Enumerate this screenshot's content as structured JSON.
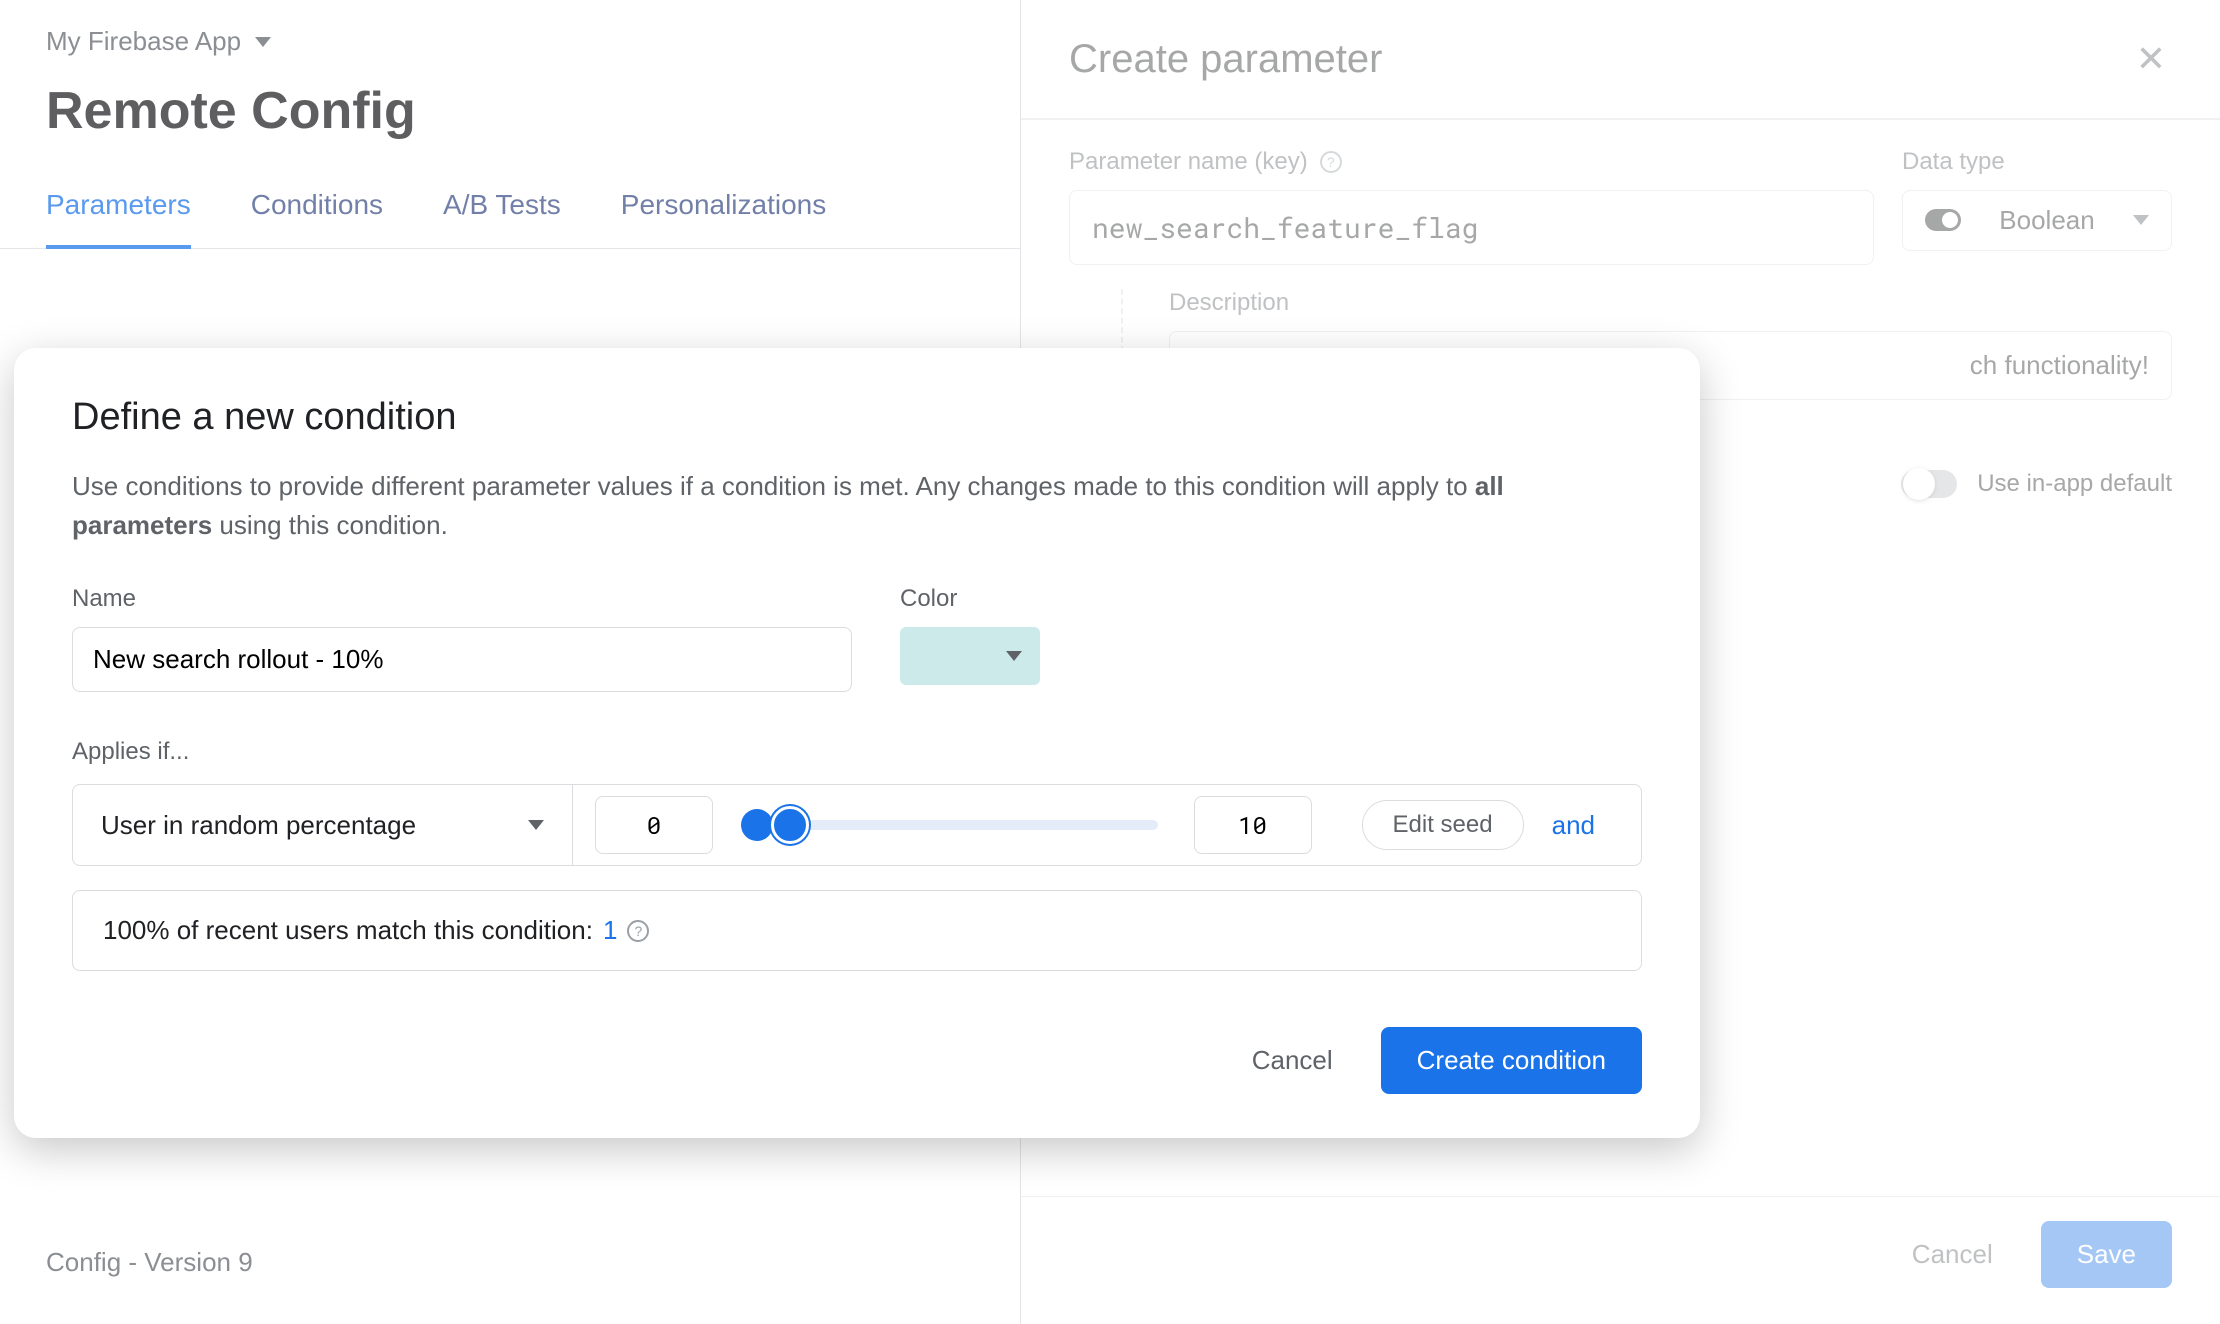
{
  "project": {
    "name": "My Firebase App"
  },
  "page": {
    "title": "Remote Config",
    "version": "Config - Version 9"
  },
  "tabs": [
    "Parameters",
    "Conditions",
    "A/B Tests",
    "Personalizations"
  ],
  "active_tab": 0,
  "drawer": {
    "title": "Create parameter",
    "param_label": "Parameter name (key)",
    "param_value": "new_search_feature_flag",
    "type_label": "Data type",
    "type_value": "Boolean",
    "desc_label": "Description",
    "desc_value_suffix": "ch functionality!",
    "inapp_label": "Use in-app default",
    "cancel": "Cancel",
    "save": "Save"
  },
  "modal": {
    "title": "Define a new condition",
    "help_pre": "Use conditions to provide different parameter values if a condition is met. Any changes made to this condition will apply to ",
    "help_bold": "all parameters",
    "help_post": " using this condition.",
    "name_label": "Name",
    "name_value": "New search rollout - 10%",
    "color_label": "Color",
    "color_value": "#cdeaea",
    "applies": "Applies if...",
    "selector": "User in random percentage",
    "range_min": "0",
    "range_max": "10",
    "edit_seed": "Edit seed",
    "and": "and",
    "match_text": "100% of recent users match this condition: ",
    "match_count": "1",
    "cancel": "Cancel",
    "create": "Create condition"
  }
}
